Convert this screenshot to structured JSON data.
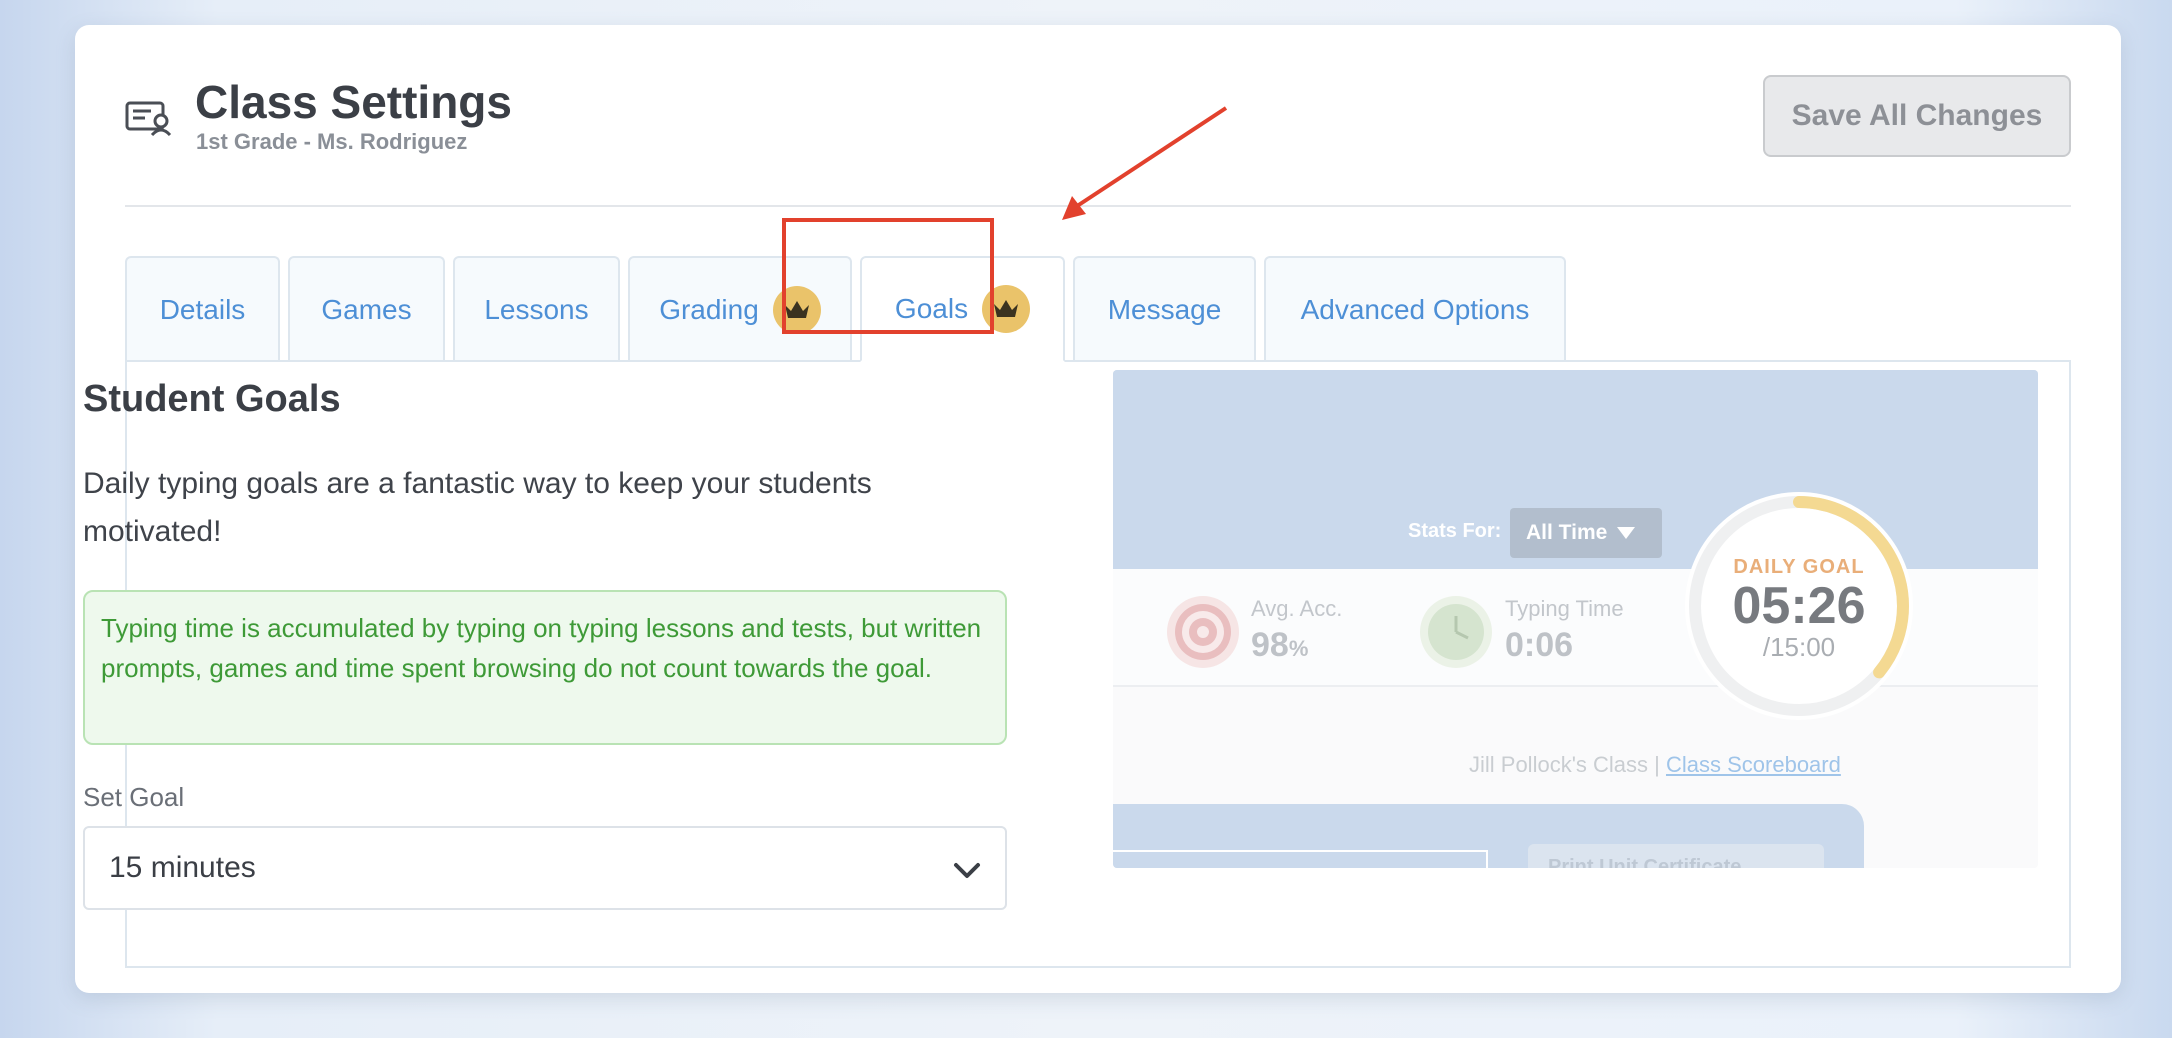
{
  "header": {
    "title": "Class Settings",
    "subtitle": "1st Grade - Ms. Rodriguez",
    "save_label": "Save All Changes"
  },
  "tabs": [
    {
      "label": "Details",
      "premium": false
    },
    {
      "label": "Games",
      "premium": false
    },
    {
      "label": "Lessons",
      "premium": false
    },
    {
      "label": "Grading",
      "premium": true
    },
    {
      "label": "Goals",
      "premium": true,
      "active": true
    },
    {
      "label": "Message",
      "premium": false
    },
    {
      "label": "Advanced Options",
      "premium": false
    }
  ],
  "goals": {
    "title": "Student Goals",
    "description": "Daily typing goals are a fantastic way to keep your students motivated!",
    "notice": "Typing time is accumulated by typing on typing lessons and tests, but written prompts, games and time spent browsing do not count towards the goal.",
    "set_goal_label": "Set Goal",
    "selected_goal": "15 minutes"
  },
  "preview": {
    "stats_for_label": "Stats For:",
    "stats_for_value": "All Time",
    "accuracy_label": "Avg. Acc.",
    "accuracy_value": "98",
    "accuracy_unit": "%",
    "typing_time_label": "Typing Time",
    "typing_time_value": "0:06",
    "daily_goal_label": "DAILY GOAL",
    "daily_goal_value": "05:26",
    "daily_goal_target": "/15:00",
    "daily_goal_progress": 0.36,
    "class_name": "Jill Pollock's Class |",
    "scoreboard_link": "Class Scoreboard",
    "print_button": "Print Unit Certificate"
  },
  "colors": {
    "accent": "#4d8fd6",
    "highlight": "#e2412d",
    "premium_badge": "#eac36a",
    "notice_text": "#3e9a37",
    "goal_ring": "#f0cd6e"
  }
}
